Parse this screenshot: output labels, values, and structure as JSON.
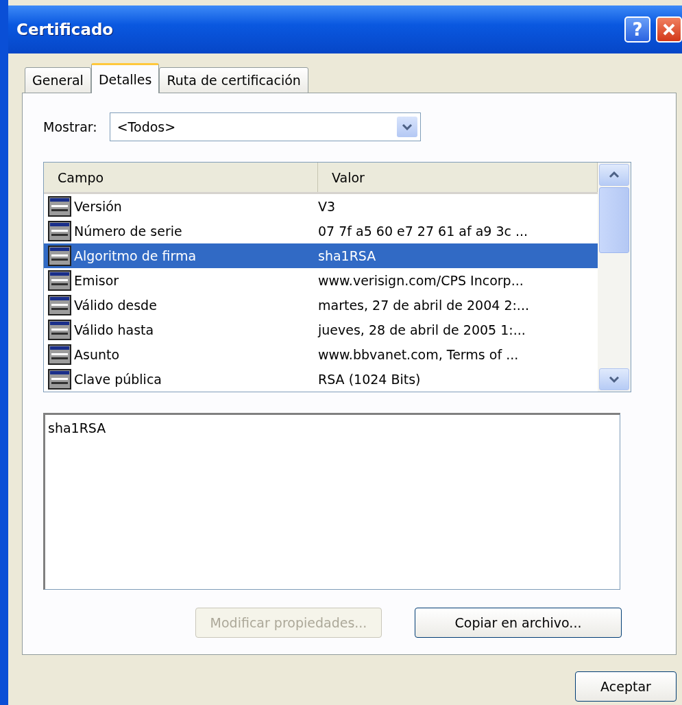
{
  "window": {
    "title": "Certificado",
    "help_button": "?"
  },
  "tabs": [
    {
      "label": "General",
      "selected": false
    },
    {
      "label": "Detalles",
      "selected": true
    },
    {
      "label": "Ruta de certificación",
      "selected": false
    }
  ],
  "show": {
    "label": "Mostrar:",
    "value": "<Todos>"
  },
  "table": {
    "columns": [
      "Campo",
      "Valor"
    ],
    "rows": [
      {
        "field": "Versión",
        "value": "V3",
        "selected": false
      },
      {
        "field": "Número de serie",
        "value": "07 7f a5 60 e7 27 61 af a9 3c ...",
        "selected": false
      },
      {
        "field": "Algoritmo de firma",
        "value": "sha1RSA",
        "selected": true
      },
      {
        "field": "Emisor",
        "value": "www.verisign.com/CPS Incorp...",
        "selected": false
      },
      {
        "field": "Válido desde",
        "value": "martes, 27 de abril de 2004 2:...",
        "selected": false
      },
      {
        "field": "Válido hasta",
        "value": "jueves, 28 de abril de 2005 1:...",
        "selected": false
      },
      {
        "field": "Asunto",
        "value": "www.bbvanet.com, Terms of ...",
        "selected": false
      },
      {
        "field": "Clave pública",
        "value": "RSA (1024 Bits)",
        "selected": false
      }
    ]
  },
  "detail": {
    "value": "sha1RSA"
  },
  "buttons": [
    {
      "label": "Modificar propiedades...",
      "disabled": true
    },
    {
      "label": "Copiar en archivo...",
      "disabled": false
    }
  ],
  "footer_buttons": [
    {
      "label": "Aceptar",
      "disabled": false
    }
  ]
}
